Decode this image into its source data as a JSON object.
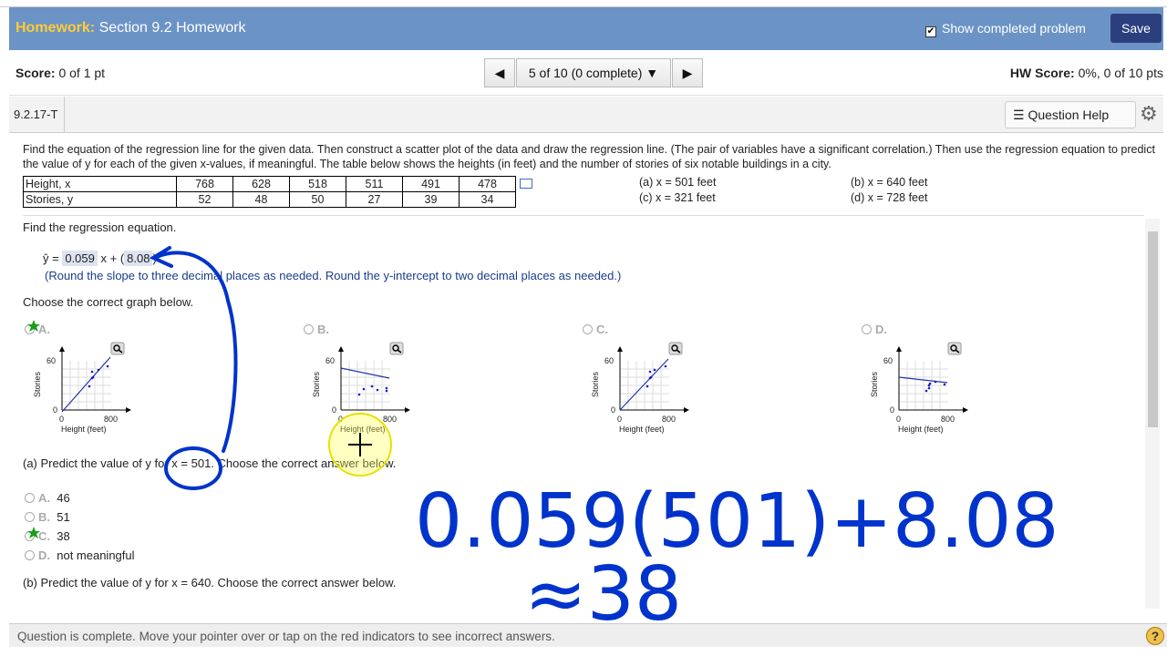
{
  "header": {
    "hw_label": "Homework:",
    "hw_title": "Section 9.2 Homework",
    "show_completed": "Show completed problem",
    "save_label": "Save"
  },
  "scorebar": {
    "score_label": "Score:",
    "score_value": "0 of 1 pt",
    "nav_label": "5 of 10 (0 complete)",
    "hw_score_label": "HW Score:",
    "hw_score_value": "0%, 0 of 10 pts"
  },
  "qbar": {
    "question_id": "9.2.17-T",
    "question_help": "Question Help"
  },
  "problem": {
    "text": "Find the equation of the regression line for the given data. Then construct a scatter plot of the data and draw the regression line. (The pair of variables have a significant correlation.) Then use the regression equation to predict the value of y for each of the given x-values, if meaningful. The table below shows the heights (in feet) and the number of stories of six notable buildings in a city.",
    "table": {
      "row1_label": "Height, x",
      "row1": [
        "768",
        "628",
        "518",
        "511",
        "491",
        "478"
      ],
      "row2_label": "Stories, y",
      "row2": [
        "52",
        "48",
        "50",
        "27",
        "39",
        "34"
      ]
    },
    "parts": {
      "a": "(a) x = 501 feet",
      "b": "(b) x = 640 feet",
      "c": "(c) x = 321 feet",
      "d": "(d) x = 728 feet"
    }
  },
  "regression": {
    "prompt": "Find the regression equation.",
    "yhat": "ŷ =",
    "slope": "0.059",
    "x_plus": "x + (",
    "intercept": "8.08",
    "close": ")",
    "note": "(Round the slope to three decimal places as needed. Round the y-intercept to two decimal places as needed.)",
    "graph_prompt": "Choose the correct graph below."
  },
  "graphs": {
    "options": [
      "A.",
      "B.",
      "C.",
      "D."
    ],
    "ylabel": "Stories",
    "xlabel": "Height (feet)",
    "y_tick": "60",
    "x_tick_0": "0",
    "x_tick_800": "800",
    "y_tick_0": "0"
  },
  "partA": {
    "question": "(a) Predict the value of y for x = 501. Choose the correct answer below.",
    "options": [
      {
        "letter": "A.",
        "text": "46"
      },
      {
        "letter": "B.",
        "text": "51"
      },
      {
        "letter": "C.",
        "text": "38"
      },
      {
        "letter": "D.",
        "text": "not meaningful"
      }
    ]
  },
  "partB": {
    "question": "(b) Predict the value of y for x = 640. Choose the correct answer below."
  },
  "handwriting": {
    "line1": "0.059(501)+8.08",
    "line2": "≈38"
  },
  "footer": {
    "message": "Question is complete. Move your pointer over or tap on the red indicators to see incorrect answers.",
    "help": "?"
  },
  "colors": {
    "header_bg": "#6b93c6",
    "hw_label": "#ffcc33",
    "save_bg": "#2b3f7e",
    "ink": "#0033cc",
    "star": "#1a9e1a",
    "points": "#1a1acc"
  }
}
